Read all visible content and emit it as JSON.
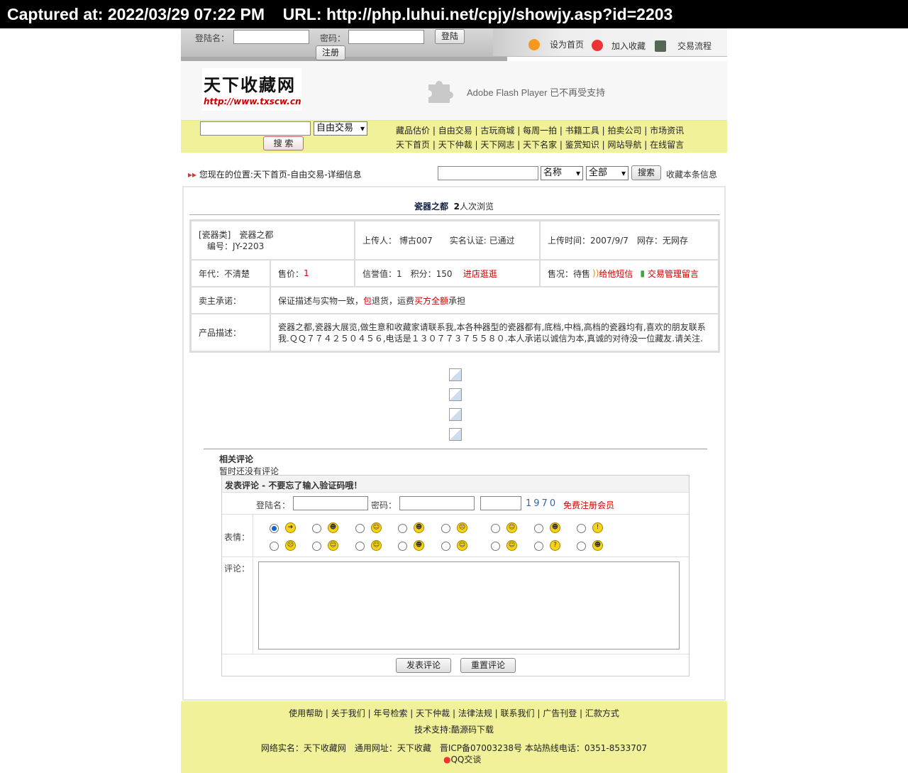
{
  "capture": {
    "text": "Captured at: 2022/03/29 07:22 PM    URL: http://php.luhui.net/cpjy/showjy.asp?id=2203"
  },
  "login": {
    "user_label": "登陆名：",
    "pass_label": "密码：",
    "login_btn": "登陆",
    "register_btn": "注册"
  },
  "toplinks": {
    "home": "设为首页",
    "fav": "加入收藏",
    "flow": "交易流程"
  },
  "logo": {
    "title": "天下收藏网",
    "url": "http://www.txscw.cn"
  },
  "flash": "Adobe Flash Player 已不再受支持",
  "search": {
    "type_select": "自由交易",
    "search_btn": "搜 索"
  },
  "nav": {
    "row1": [
      "藏品估价",
      "自由交易",
      "古玩商城",
      "每周一拍",
      "书籍工具",
      "拍卖公司",
      "市场资讯"
    ],
    "row2": [
      "天下首页",
      "天下仲裁",
      "天下网志",
      "天下名家",
      "鉴赏知识",
      "网站导航",
      "在线留言"
    ]
  },
  "location": {
    "text": "您现在的位置:天下首页-自由交易-详细信息",
    "field_select": "名称",
    "scope_select": "全部",
    "search_btn": "搜索",
    "collect": "收藏本条信息"
  },
  "item": {
    "name": "瓷器之都",
    "views_num": "2",
    "views_suffix": "人次浏览",
    "category": "[瓷器类]　瓷器之都",
    "code": "编号：JY-2203",
    "uploader": "上传人：  博古007　　实名认证: 已通过",
    "upload_time": "上传时间：2007/9/7　网存：无网存",
    "era": "年代：不清楚",
    "price_label": "售价：",
    "price": "1",
    "credit": "信誉值：1　积分：150",
    "shop_link": "进店逛逛",
    "status": "售况：待售",
    "sms_link": "给他短信",
    "manage_link": "交易管理留言",
    "promise_label": "卖主承诺：",
    "promise_pre": "保证描述与实物一致，",
    "promise_bao": "包",
    "promise_mid": "退货，运费",
    "promise_buyer": "买方全额",
    "promise_post": "承担",
    "desc_label": "产品描述：",
    "desc": "瓷器之都,瓷器大展览,做生意和收藏家请联系我,本各种器型的瓷器都有,底档,中档,高档的瓷器均有,喜欢的朋友联系我.ＱＱ７７４２５０４５６,电话是１３０７７３７５５８０.本人承诺以诚信为本,真诚的对待没一位藏友.请关注."
  },
  "comments": {
    "title": "相关评论",
    "empty": "暂时还没有评论",
    "form_title": "发表评论 - 不要忘了输入验证码哦！",
    "user_label": "登陆名：",
    "pass_label": "密码：",
    "captcha": "1970",
    "register_link": "免费注册会员",
    "emotion_label": "表情：",
    "comment_label": "评论：",
    "submit_btn": "发表评论",
    "reset_btn": "重置评论"
  },
  "footer": {
    "links": [
      "使用帮助",
      "关于我们",
      "年号检索",
      "天下仲裁",
      "法律法规",
      "联系我们",
      "广告刊登",
      "汇款方式"
    ],
    "support": "技术支持:酷源码下载",
    "info": "网络实名：天下收藏网　通用网址：天下收藏　晋ICP备07003238号 本站热线电话：0351-8533707",
    "qq": "QQ交谈"
  },
  "colors": {
    "nav_bg": "#f1f19a",
    "red": "#cc0000"
  }
}
